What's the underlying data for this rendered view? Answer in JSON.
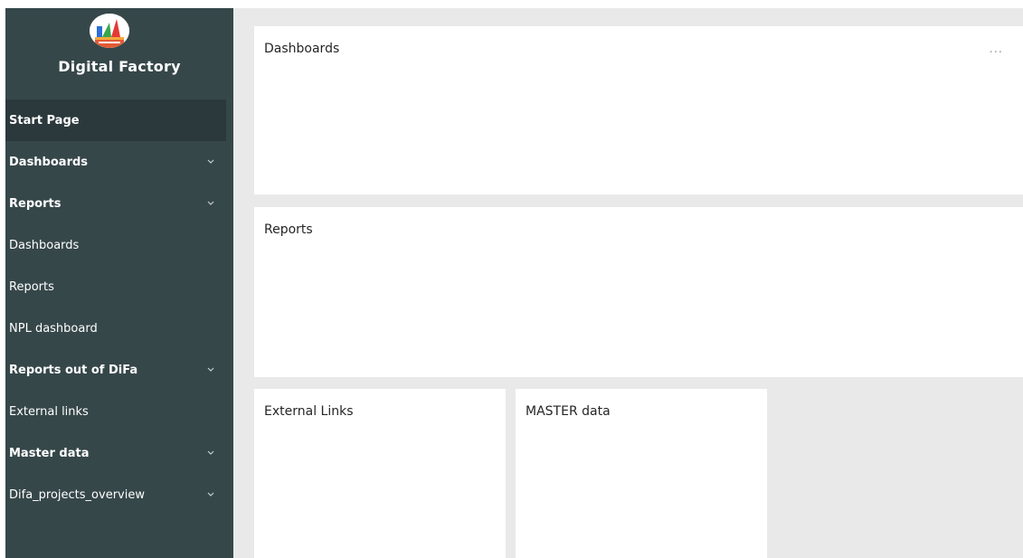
{
  "app": {
    "title": "Digital Factory"
  },
  "sidebar": {
    "items": [
      {
        "label": "Start Page"
      },
      {
        "label": "Dashboards"
      },
      {
        "label": "Reports"
      },
      {
        "label": "Dashboards"
      },
      {
        "label": "Reports"
      },
      {
        "label": "NPL dashboard"
      },
      {
        "label": "Reports out of DiFa"
      },
      {
        "label": "External links"
      },
      {
        "label": "Master data"
      },
      {
        "label": "Difa_projects_overview"
      }
    ]
  },
  "main": {
    "cards": [
      {
        "title": "Dashboards",
        "more": "..."
      },
      {
        "title": "Reports"
      },
      {
        "title": "External Links"
      },
      {
        "title": "MASTER data"
      }
    ]
  },
  "colors": {
    "sidebar_bg": "#36474a",
    "active_bg": "#2b393c",
    "canvas_bg": "#e9e9e9",
    "card_bg": "#ffffff"
  },
  "icons": {
    "logo": "digital-factory-logo",
    "expand": "chevron-down-icon",
    "more": "more-options-icon"
  }
}
